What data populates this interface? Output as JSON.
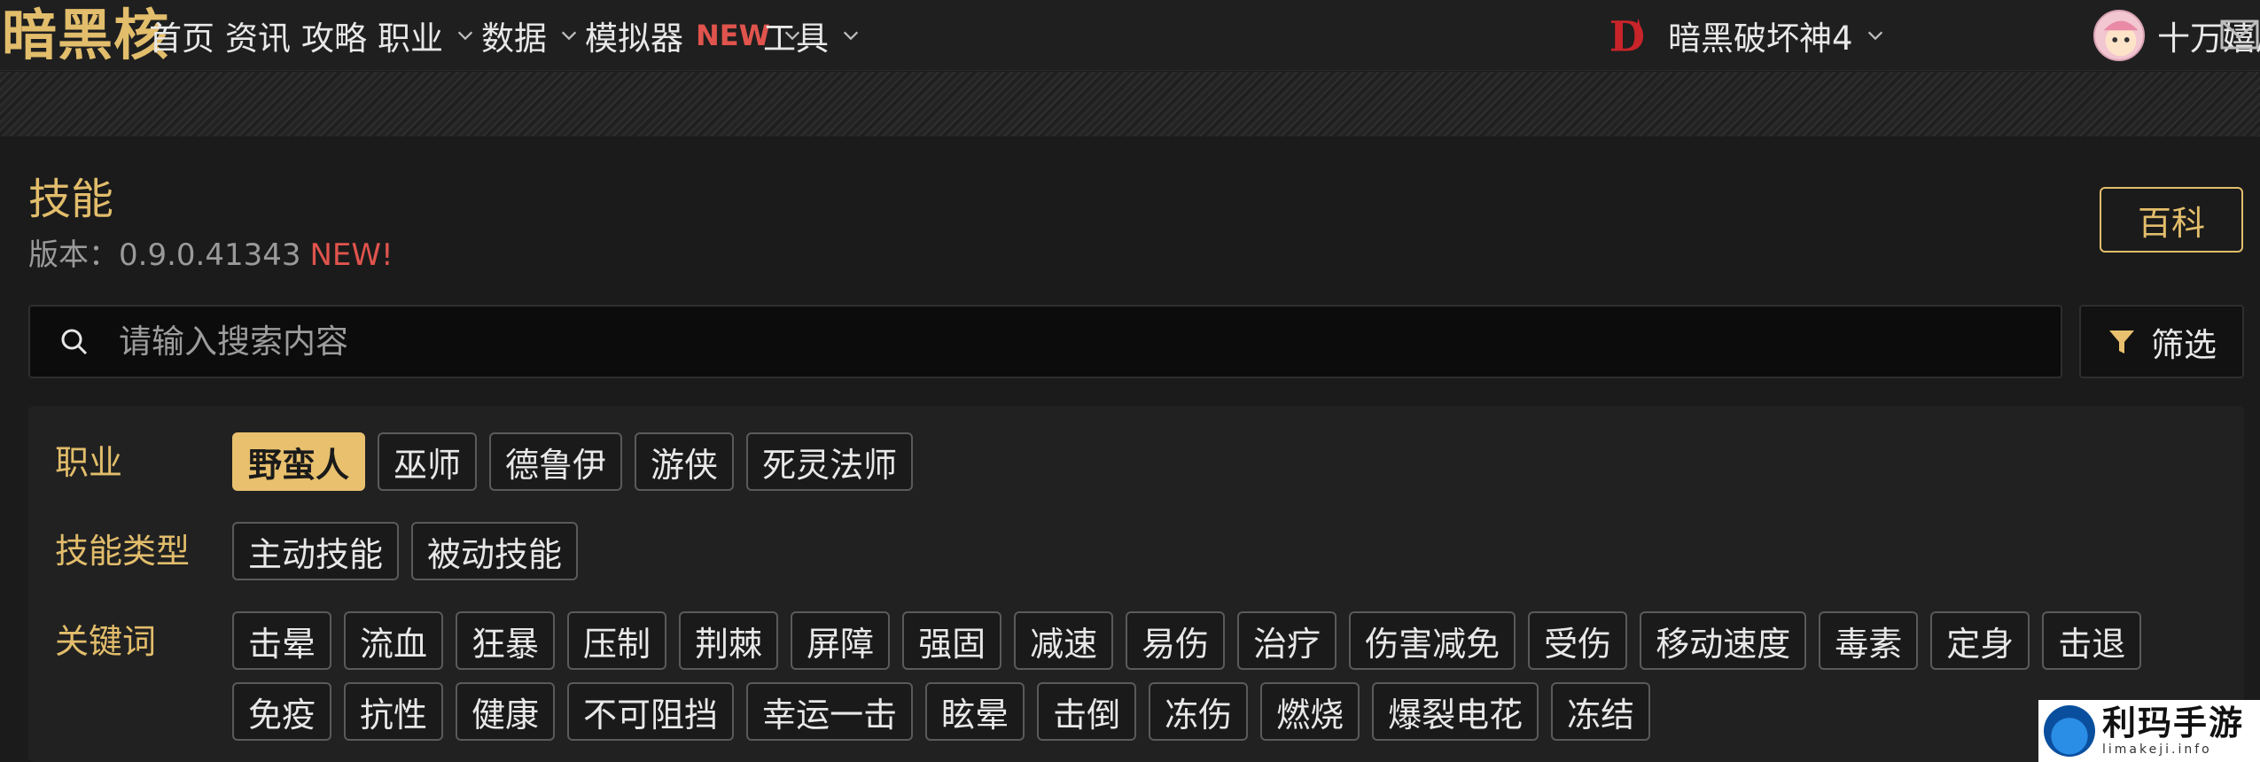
{
  "nav": {
    "logo": "暗黑核",
    "items": [
      {
        "label": "首页"
      },
      {
        "label": "资讯"
      },
      {
        "label": "攻略"
      },
      {
        "label": "职业"
      },
      {
        "label": "数据"
      },
      {
        "label": "模拟器",
        "badge": "NEW"
      },
      {
        "label": "工具"
      }
    ],
    "game": "暗黑破坏神4",
    "user": "十万嬉皮"
  },
  "page": {
    "title": "技能",
    "version_label": "版本：0.9.0.41343",
    "version_badge": "NEW!",
    "wiki_button": "百科"
  },
  "search": {
    "placeholder": "请输入搜索内容",
    "value": "",
    "filter_button": "筛选"
  },
  "filters": {
    "class": {
      "label": "职业",
      "options": [
        "野蛮人",
        "巫师",
        "德鲁伊",
        "游侠",
        "死灵法师"
      ],
      "selected": "野蛮人"
    },
    "skill_type": {
      "label": "技能类型",
      "options": [
        "主动技能",
        "被动技能"
      ]
    },
    "keywords": {
      "label": "关键词",
      "options": [
        "击晕",
        "流血",
        "狂暴",
        "压制",
        "荆棘",
        "屏障",
        "强固",
        "减速",
        "易伤",
        "治疗",
        "伤害减免",
        "受伤",
        "移动速度",
        "毒素",
        "定身",
        "击退",
        "免疫",
        "抗性",
        "健康",
        "不可阻挡",
        "幸运一击",
        "眩晕",
        "击倒",
        "冻伤",
        "燃烧",
        "爆裂电花",
        "冻结"
      ]
    }
  },
  "watermark": {
    "title": "利玛手游",
    "domain": "limakeji.info"
  },
  "colors": {
    "accent": "#e2bd6b",
    "new_badge": "#e0544d",
    "background": "#1b1b1b"
  }
}
